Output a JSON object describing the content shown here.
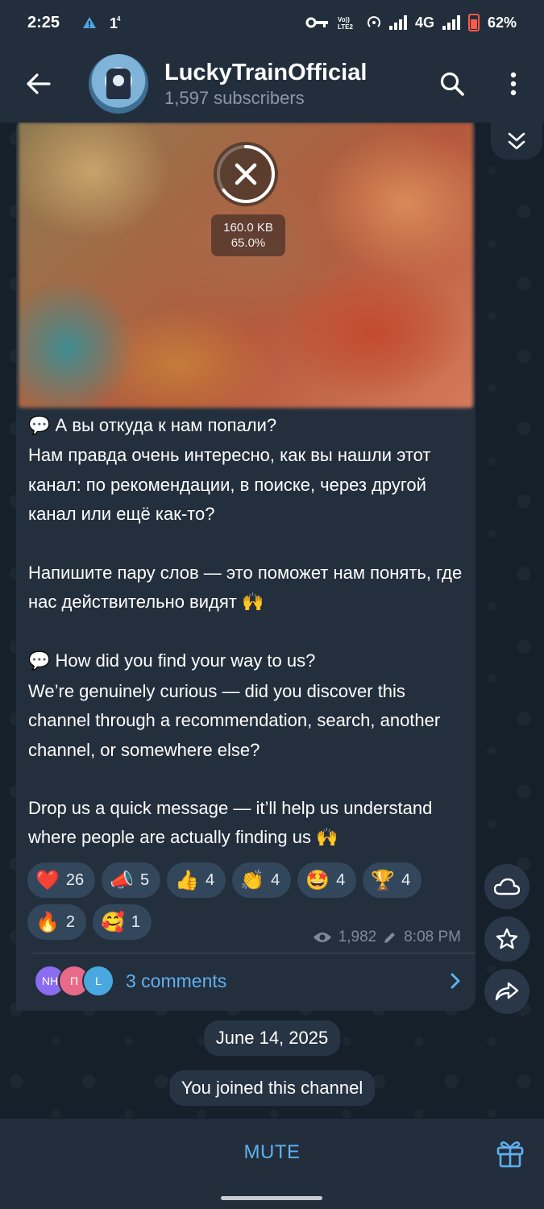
{
  "status_bar": {
    "time": "2:25",
    "left_icons": [
      "alert-triangle-icon",
      "one-notification-icon"
    ],
    "right_icons": [
      "key-icon",
      "volte-icon",
      "hotspot-icon",
      "signal-icon",
      "network-4g-icon",
      "battery-icon"
    ],
    "network": "4G",
    "volte": "VoLTE2",
    "battery": "62%"
  },
  "header": {
    "channel_name": "LuckyTrainOfficial",
    "subscribers": "1,597 subscribers"
  },
  "message": {
    "media": {
      "size": "160.0 KB",
      "progress": "65.0%",
      "progress_value": 0.65
    },
    "paragraphs": [
      {
        "emoji": "💬",
        "text": "А вы откуда к нам попали?"
      },
      {
        "text": "Нам правда очень интересно, как вы нашли этот канал: по рекомендации, в поиске, через другой канал или ещё как-то?"
      },
      {
        "text": "Напишите пару слов — это поможет нам понять, где нас действительно видят",
        "emoji_end": "🙌"
      },
      {
        "emoji": "💬",
        "text": "How did you find your way to us?"
      },
      {
        "text": "We’re genuinely curious — did you discover this channel through a recommendation, search, another channel, or somewhere else?"
      },
      {
        "text": "Drop us a quick message — it’ll help us understand where people are actually finding us",
        "emoji_end": "🙌"
      }
    ],
    "reactions": [
      {
        "emoji": "❤️",
        "count": "26"
      },
      {
        "emoji": "📣",
        "count": "5"
      },
      {
        "emoji": "👍",
        "count": "4"
      },
      {
        "emoji": "👏",
        "count": "4"
      },
      {
        "emoji": "🤩",
        "count": "4"
      },
      {
        "emoji": "🏆",
        "count": "4"
      },
      {
        "emoji": "🔥",
        "count": "2"
      },
      {
        "emoji": "🥰",
        "count": "1"
      }
    ],
    "views": "1,982",
    "time": "8:08 PM",
    "comments": {
      "avatars": [
        {
          "initials": "NH",
          "color": "#8a6cf0"
        },
        {
          "initials": "П",
          "color": "#e86a8a"
        },
        {
          "initials": "L",
          "color": "#4aa8e0"
        }
      ],
      "label": "3 comments"
    }
  },
  "service": {
    "date": "June 14, 2025",
    "joined": "You joined this channel"
  },
  "bottom": {
    "mute_label": "MUTE"
  },
  "colors": {
    "accent": "#5fb0ef",
    "header_bg": "#232e3c",
    "bubble_bg": "#232f3d",
    "chat_bg": "#16202b"
  }
}
